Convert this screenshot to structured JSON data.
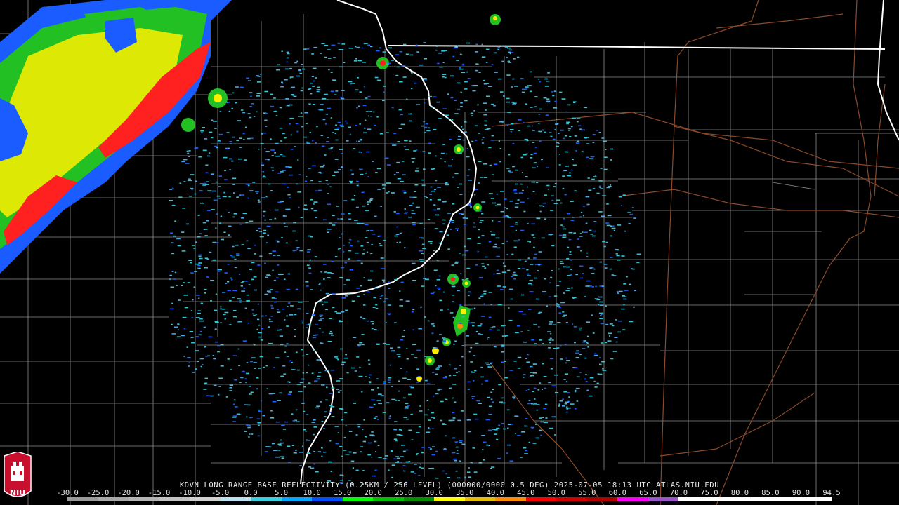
{
  "product_caption": "KDVN LONG RANGE BASE REFLECTIVITY (0.25KM / 256 LEVEL) (000000/0000 0.5 DEG) 2025-07-05 18:13 UTC  ATLAS.NIU.EDU",
  "logo_text": "NIU",
  "colors": {
    "background": "#000000",
    "state_border": "#ffffff",
    "county_border": "#8c8c8c",
    "highway": "#8a4a2a",
    "echo_light": "#35c4d6",
    "echo_blue": "#1a5cff",
    "echo_green": "#22c022",
    "echo_yellow": "#ffee00",
    "echo_red": "#ff2020",
    "logo_red": "#c8102e"
  },
  "radar_site": "KDVN",
  "scale": {
    "labels": [
      "-30.0",
      "-25.0",
      "-20.0",
      "-15.0",
      "-10.0",
      "-5.0",
      "0.0",
      "5.0",
      "10.0",
      "15.0",
      "20.0",
      "25.0",
      "30.0",
      "35.0",
      "40.0",
      "45.0",
      "50.0",
      "55.0",
      "60.0",
      "65.0",
      "70.0",
      "75.0",
      "80.0",
      "85.0",
      "90.0",
      "94.5"
    ],
    "colors": [
      "#9a9a9a",
      "#a8a8a8",
      "#b4b4b4",
      "#c2c2c2",
      "#d0d0d0",
      "#b8e2ee",
      "#38d0e0",
      "#00a8ff",
      "#0050ff",
      "#00ff00",
      "#00c000",
      "#009000",
      "#ffff00",
      "#e6c000",
      "#ff8c00",
      "#ff0000",
      "#d40000",
      "#b00000",
      "#ff00ff",
      "#9955c9",
      "#ffffff",
      "#ffffff",
      "#ffffff",
      "#ffffff",
      "#ffffff"
    ]
  }
}
